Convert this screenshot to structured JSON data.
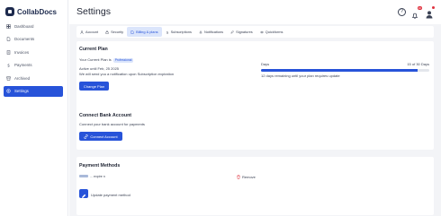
{
  "app": {
    "name": "CollabDocs"
  },
  "sidebar": {
    "items": [
      {
        "label": "Dashboard",
        "icon": "dashboard-icon",
        "active": false
      },
      {
        "label": "Documents",
        "icon": "document-icon",
        "active": false
      },
      {
        "label": "Invoices",
        "icon": "invoice-icon",
        "active": false
      },
      {
        "label": "Payments",
        "icon": "payments-icon",
        "active": false
      },
      {
        "label": "Archived",
        "icon": "archive-icon",
        "active": false
      },
      {
        "label": "Settings",
        "icon": "settings-icon",
        "active": true
      }
    ]
  },
  "header": {
    "title": "Settings",
    "notification_count": "10",
    "icons": [
      "help-icon",
      "bell-icon",
      "avatar"
    ]
  },
  "tabs": [
    {
      "label": "Account",
      "icon": "user-icon",
      "active": false
    },
    {
      "label": "Security",
      "icon": "lock-icon",
      "active": false
    },
    {
      "label": "Billing & plans",
      "icon": "document-icon",
      "active": true
    },
    {
      "label": "Subscriptions",
      "icon": "dollar-icon",
      "active": false
    },
    {
      "label": "Notifications",
      "icon": "bell-icon",
      "active": false
    },
    {
      "label": "Signatures",
      "icon": "pen-icon",
      "active": false
    },
    {
      "label": "Quickforms",
      "icon": "eye-icon",
      "active": false
    }
  ],
  "current_plan": {
    "title": "Current Plan",
    "plan_prefix": "Your Current Plan is",
    "plan_name": "Professional",
    "active_until": "Active until Feb, 25 2025",
    "reminder": "We will send you a notification upon Subscription expiration",
    "change_button": "Change Plan",
    "days_label": "Days",
    "days_count": "15 of 30 Days",
    "days_progress_fraction": 0.93,
    "days_remaining": "12 days remaining until your plan requires update"
  },
  "bank": {
    "title": "Connect Bank Account",
    "description": "Connect your bank account for payments",
    "button": "Connect Account"
  },
  "payment_methods": {
    "title": "Payment Methods",
    "card_text": "... expire n",
    "remove_label": "Remove",
    "update_label": "Update payment method"
  },
  "colors": {
    "accent": "#2753d9",
    "accent_light": "#dbe5fb",
    "danger": "#e0323f",
    "bg": "#f3f4f7"
  }
}
